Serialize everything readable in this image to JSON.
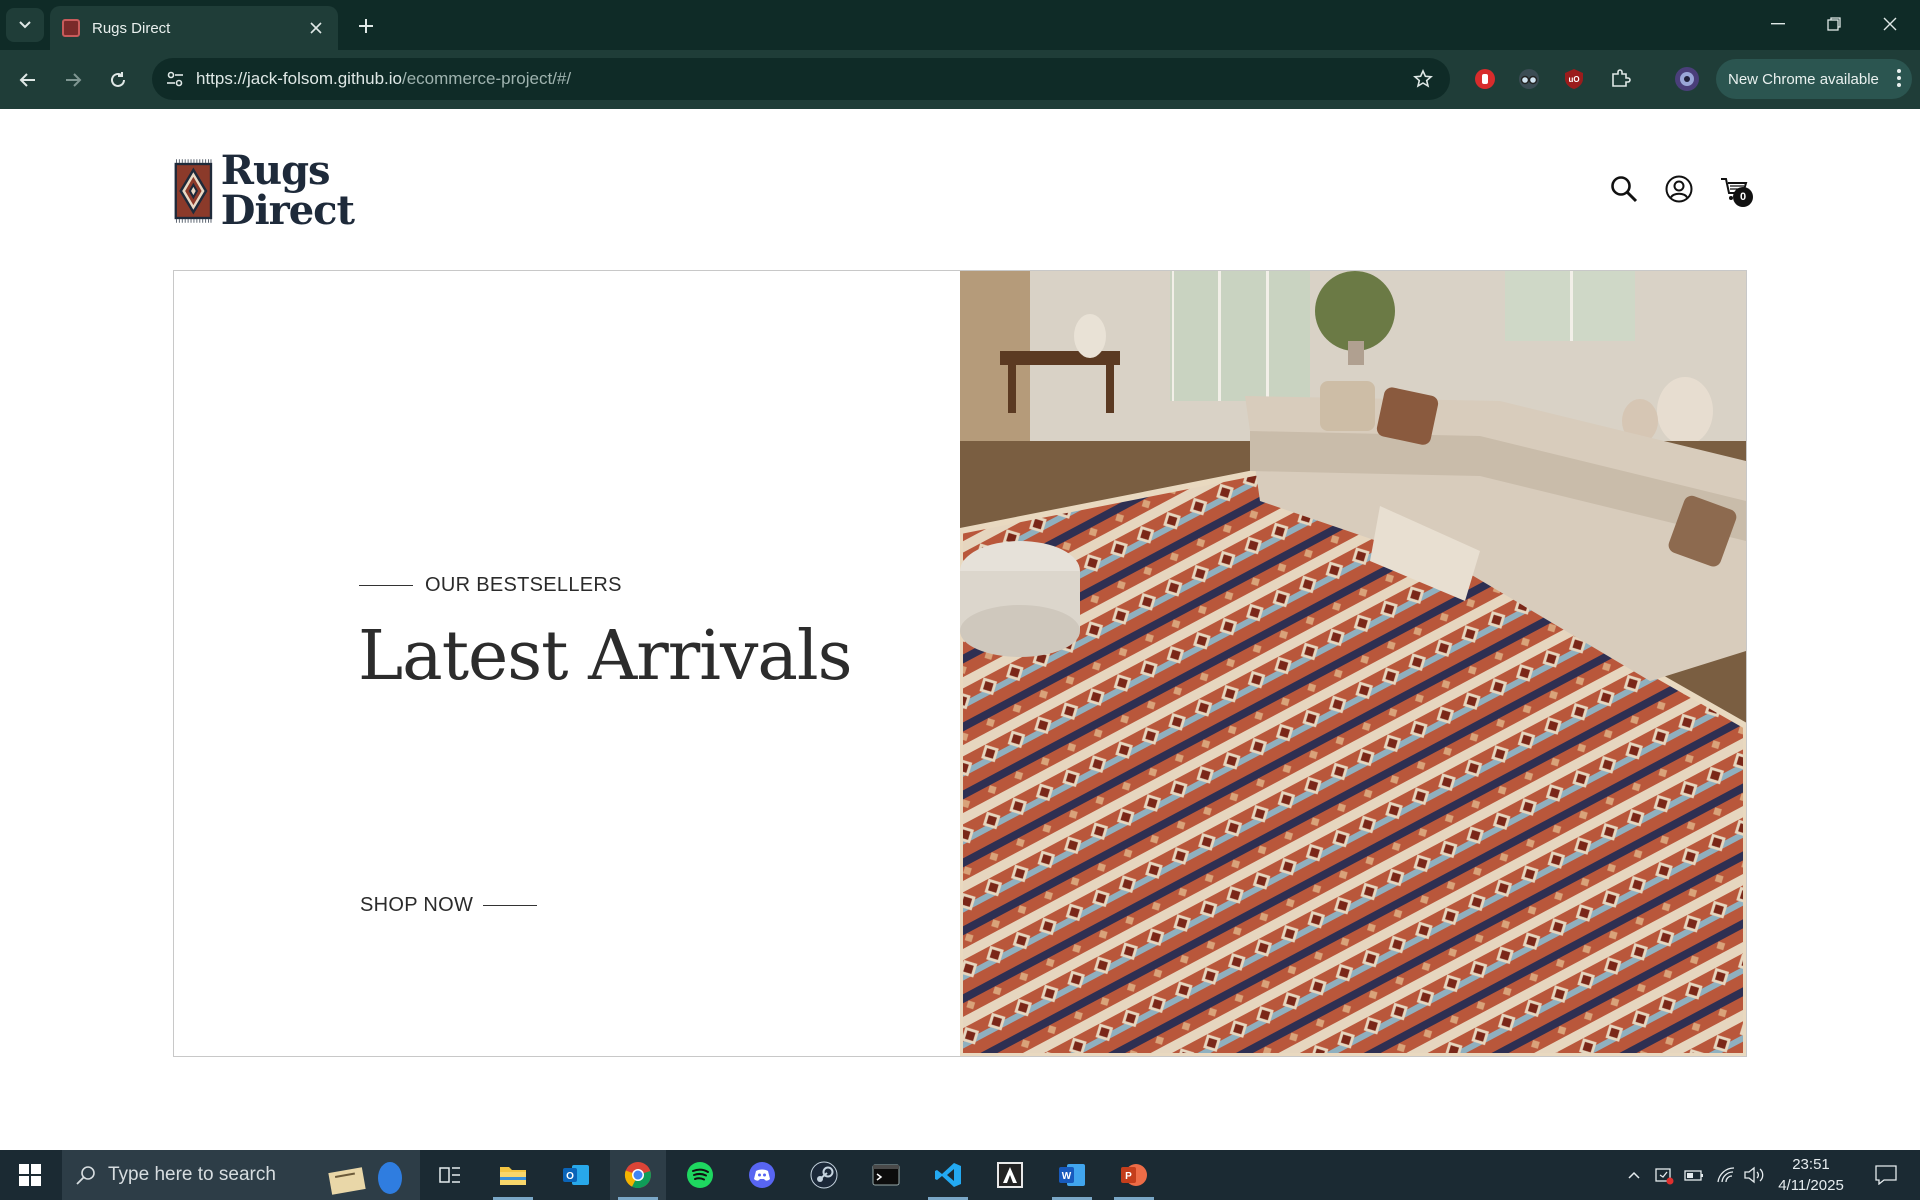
{
  "browser": {
    "tab": {
      "title": "Rugs Direct"
    },
    "url": {
      "host": "https://jack-folsom.github.io",
      "path": "/ecommerce-project/#/"
    },
    "update_label": "New Chrome available"
  },
  "site": {
    "logo": {
      "line1": "Rugs",
      "line2": "Direct"
    },
    "cart_count": "0",
    "hero": {
      "eyebrow": "OUR BESTSELLERS",
      "headline": "Latest Arrivals",
      "cta": "SHOP NOW"
    }
  },
  "taskbar": {
    "search_placeholder": "Type here to search",
    "time": "23:51",
    "date": "4/11/2025"
  },
  "colors": {
    "chrome_dark": "#0f2b27",
    "chrome_mid": "#1f3d38",
    "logo_navy": "#1e2a3a",
    "rug_red": "#8b3a2a"
  }
}
